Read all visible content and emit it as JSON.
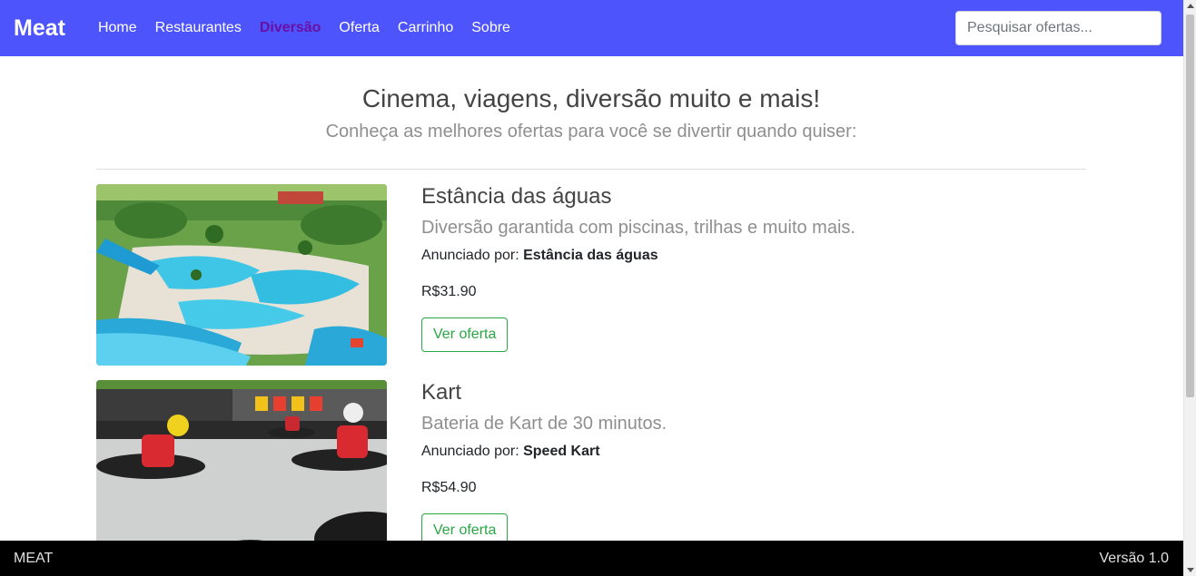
{
  "navbar": {
    "brand": "Meat",
    "links": [
      {
        "label": "Home",
        "active": false
      },
      {
        "label": "Restaurantes",
        "active": false
      },
      {
        "label": "Diversão",
        "active": true
      },
      {
        "label": "Oferta",
        "active": false
      },
      {
        "label": "Carrinho",
        "active": false
      },
      {
        "label": "Sobre",
        "active": false
      }
    ],
    "search_placeholder": "Pesquisar ofertas..."
  },
  "header": {
    "title": "Cinema, viagens, diversão muito e mais!",
    "subtitle": "Conheça as melhores ofertas para você se divertir quando quiser:"
  },
  "offers": [
    {
      "title": "Estância das águas",
      "description": "Diversão garantida com piscinas, trilhas e muito mais.",
      "advertiser_label": "Anunciado por:",
      "advertiser": "Estância das águas",
      "price": "R$31.90",
      "button": "Ver oferta"
    },
    {
      "title": "Kart",
      "description": "Bateria de Kart de 30 minutos.",
      "advertiser_label": "Anunciado por:",
      "advertiser": "Speed Kart",
      "price": "R$54.90",
      "button": "Ver oferta"
    }
  ],
  "footer": {
    "left": "MEAT",
    "right": "Versão 1.0"
  },
  "colors": {
    "navbar": "#4e54fc",
    "active_link": "#6a0fa3",
    "button": "#28a745",
    "footer": "#000000"
  }
}
